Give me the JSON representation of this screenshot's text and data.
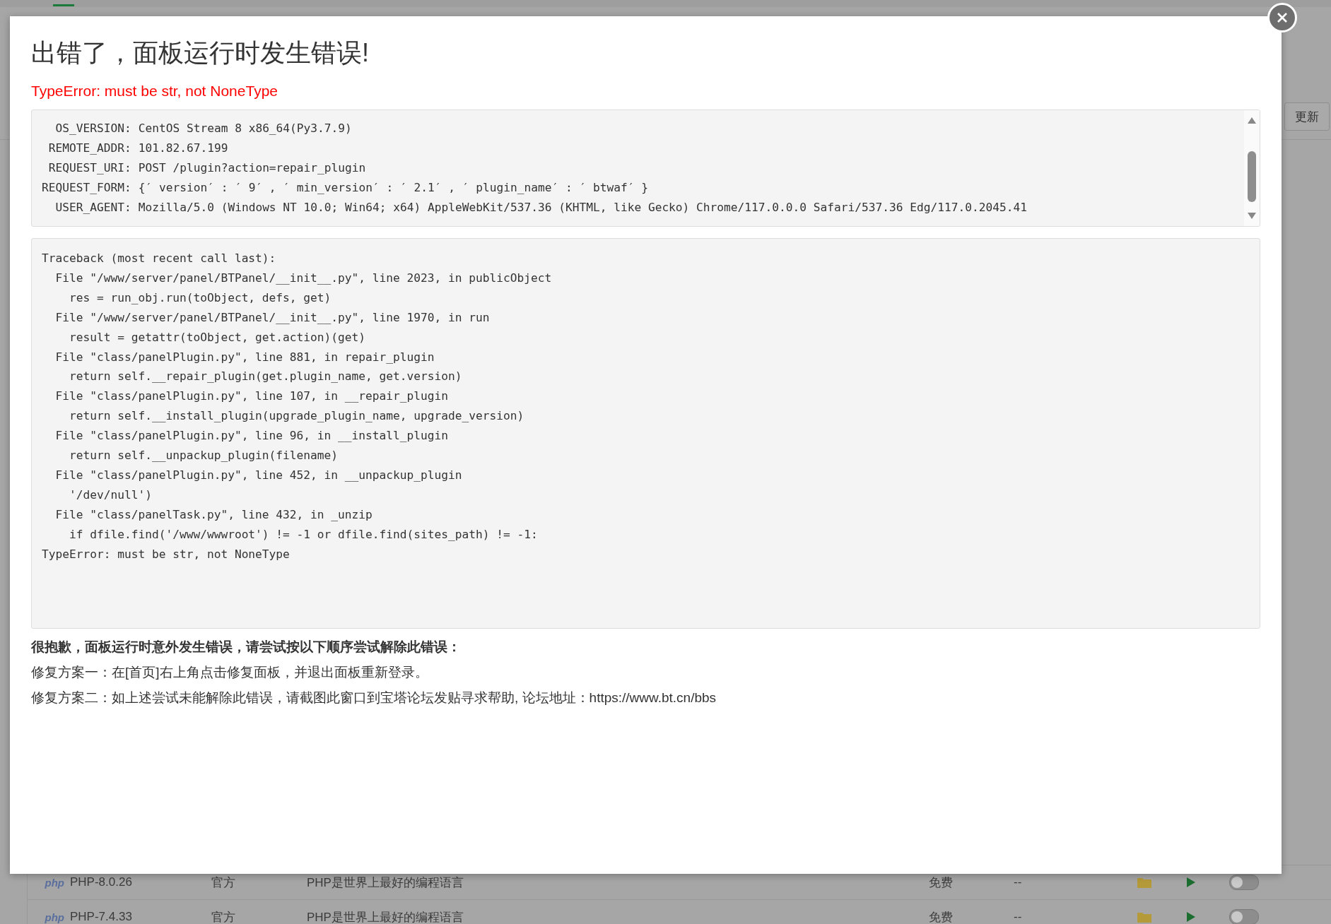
{
  "background": {
    "toolbar_button": "更新",
    "plugins": [
      {
        "logo": "php",
        "name": "PHP-8.0.26",
        "source": "官方",
        "description": "PHP是世界上最好的编程语言",
        "price": "免费",
        "expiry": "--",
        "on": false
      },
      {
        "logo": "php",
        "name": "PHP-7.4.33",
        "source": "官方",
        "description": "PHP是世界上最好的编程语言",
        "price": "免费",
        "expiry": "--",
        "on": false
      }
    ]
  },
  "dialog": {
    "title": "出错了，面板运行时发生错误!",
    "error": "TypeError: must be str, not NoneType",
    "request_info": [
      {
        "key": "OS_VERSION:",
        "value": "CentOS Stream 8 x86_64(Py3.7.9)"
      },
      {
        "key": "REMOTE_ADDR:",
        "value": "101.82.67.199"
      },
      {
        "key": "REQUEST_URI:",
        "value": "POST /plugin?action=repair_plugin"
      },
      {
        "key": "REQUEST_FORM:",
        "value": "{′ version′ : ′ 9′ , ′ min_version′ : ′ 2.1′ , ′ plugin_name′ : ′ btwaf′ }"
      },
      {
        "key": "USER_AGENT:",
        "value": "Mozilla/5.0 (Windows NT 10.0; Win64; x64) AppleWebKit/537.36 (KHTML, like Gecko) Chrome/117.0.0.0 Safari/537.36 Edg/117.0.2045.41"
      }
    ],
    "traceback": [
      "Traceback (most recent call last):",
      "  File \"/www/server/panel/BTPanel/__init__.py\", line 2023, in publicObject",
      "    res = run_obj.run(toObject, defs, get)",
      "  File \"/www/server/panel/BTPanel/__init__.py\", line 1970, in run",
      "    result = getattr(toObject, get.action)(get)",
      "  File \"class/panelPlugin.py\", line 881, in repair_plugin",
      "    return self.__repair_plugin(get.plugin_name, get.version)",
      "  File \"class/panelPlugin.py\", line 107, in __repair_plugin",
      "    return self.__install_plugin(upgrade_plugin_name, upgrade_version)",
      "  File \"class/panelPlugin.py\", line 96, in __install_plugin",
      "    return self.__unpackup_plugin(filename)",
      "  File \"class/panelPlugin.py\", line 452, in __unpackup_plugin",
      "    '/dev/null')",
      "  File \"class/panelTask.py\", line 432, in _unzip",
      "    if dfile.find('/www/wwwroot') != -1 or dfile.find(sites_path) != -1:",
      "TypeError: must be str, not NoneType"
    ],
    "help_heading": "很抱歉，面板运行时意外发生错误，请尝试按以下顺序尝试解除此错误：",
    "fix_1": "修复方案一：在[首页]右上角点击修复面板，并退出面板重新登录。",
    "fix_2": "修复方案二：如上述尝试未能解除此错误，请截图此窗口到宝塔论坛发贴寻求帮助, 论坛地址：",
    "forum_link": "https://www.bt.cn/bbs"
  }
}
